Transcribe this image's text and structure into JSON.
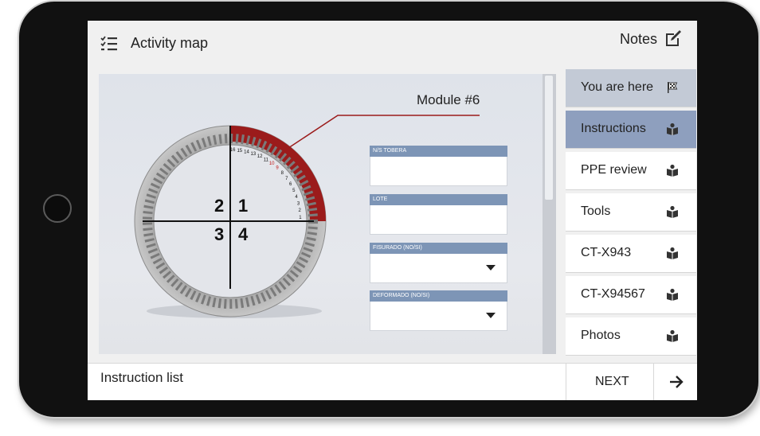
{
  "header": {
    "title": "Activity map",
    "notes_label": "Notes"
  },
  "module": {
    "label": "Module #6"
  },
  "quadrants": [
    "2",
    "1",
    "3",
    "4"
  ],
  "blade_numbers": [
    "16",
    "15",
    "14",
    "13",
    "12",
    "11",
    "10",
    "9",
    "8",
    "7",
    "6",
    "5",
    "4",
    "3",
    "2",
    "1"
  ],
  "form": {
    "fields": [
      {
        "label": "N/S TOBERA",
        "value": ""
      },
      {
        "label": "LOTE",
        "value": ""
      },
      {
        "label": "FISURADO (NO/SI)",
        "value": ""
      },
      {
        "label": "DEFORMADO (NO/SI)",
        "value": ""
      }
    ]
  },
  "sidebar": {
    "items": [
      {
        "label": "You are here",
        "icon": "flag-icon"
      },
      {
        "label": "Instructions",
        "icon": "book-reader-icon"
      },
      {
        "label": "PPE review",
        "icon": "book-reader-icon"
      },
      {
        "label": "Tools",
        "icon": "book-reader-icon"
      },
      {
        "label": "CT-X943",
        "icon": "book-reader-icon"
      },
      {
        "label": "CT-X94567",
        "icon": "book-reader-icon"
      },
      {
        "label": "Photos",
        "icon": "book-reader-icon"
      }
    ]
  },
  "footer": {
    "title": "Instruction list",
    "next_label": "NEXT"
  },
  "colors": {
    "accent": "#8e9fbe",
    "highlight_red": "#9b1b1b",
    "form_header": "#7d95b6"
  }
}
